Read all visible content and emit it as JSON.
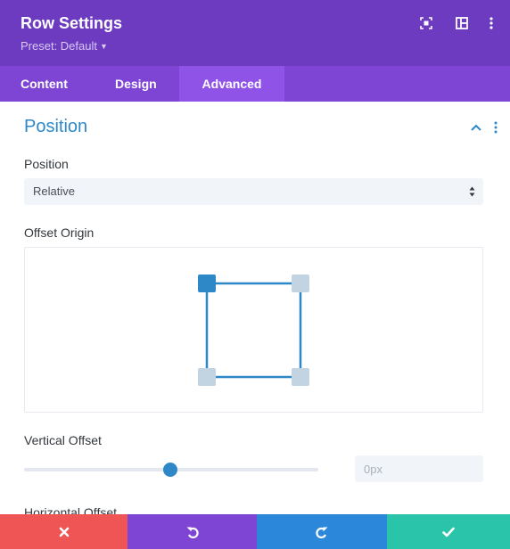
{
  "header": {
    "title": "Row Settings",
    "preset": "Preset: Default",
    "icons": [
      "focus-mode-icon",
      "layout-split-icon",
      "more-options-icon"
    ],
    "colors": {
      "background": "#6c3bc0"
    }
  },
  "tabs": [
    {
      "label": "Content",
      "active": false
    },
    {
      "label": "Design",
      "active": false
    },
    {
      "label": "Advanced",
      "active": true
    }
  ],
  "section": {
    "title": "Position",
    "expanded": true,
    "accent": "#2e88c8"
  },
  "position": {
    "label": "Position",
    "value": "Relative"
  },
  "offset_origin": {
    "label": "Offset Origin",
    "selected": "top-left",
    "options": [
      "top-left",
      "top-right",
      "bottom-left",
      "bottom-right"
    ]
  },
  "vertical_offset": {
    "label": "Vertical Offset",
    "slider_fraction": 0.5,
    "placeholder": "0px"
  },
  "horizontal_offset": {
    "label": "Horizontal Offset"
  },
  "footer": {
    "buttons": [
      {
        "name": "cancel",
        "icon": "close-icon",
        "color": "#ef5555"
      },
      {
        "name": "undo",
        "icon": "undo-icon",
        "color": "#7e44d3"
      },
      {
        "name": "redo",
        "icon": "redo-icon",
        "color": "#2b87da"
      },
      {
        "name": "save",
        "icon": "check-icon",
        "color": "#29c4a9"
      }
    ]
  }
}
